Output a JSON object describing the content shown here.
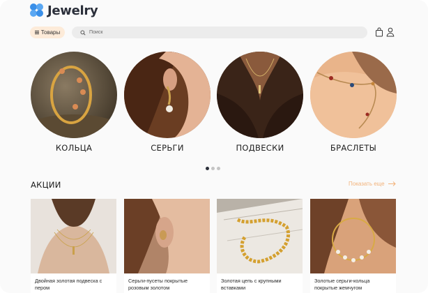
{
  "header": {
    "logo_text": "Jewelry",
    "catalog_label": "Товары",
    "search_placeholder": "Поиск"
  },
  "categories": [
    {
      "label": "КОЛЬЦА"
    },
    {
      "label": "СЕРЬГИ"
    },
    {
      "label": "ПОДВЕСКИ"
    },
    {
      "label": "БРАСЛЕТЫ"
    }
  ],
  "carousel": {
    "pages": 3,
    "active": 0
  },
  "promo": {
    "title": "АКЦИИ",
    "show_all": "Показать еще"
  },
  "products": [
    {
      "title": "Двойная золотая подвеска с пером"
    },
    {
      "title": "Серьги-пусеты покрытые розовым золотом"
    },
    {
      "title": "Золотая цепь с крупными вставками"
    },
    {
      "title": "Золотые серьги-кольца покрытые жемчугом"
    }
  ],
  "colors": {
    "accent": "#f2b27a",
    "logo": "#3a8fe8",
    "text": "#1f1f1f"
  }
}
